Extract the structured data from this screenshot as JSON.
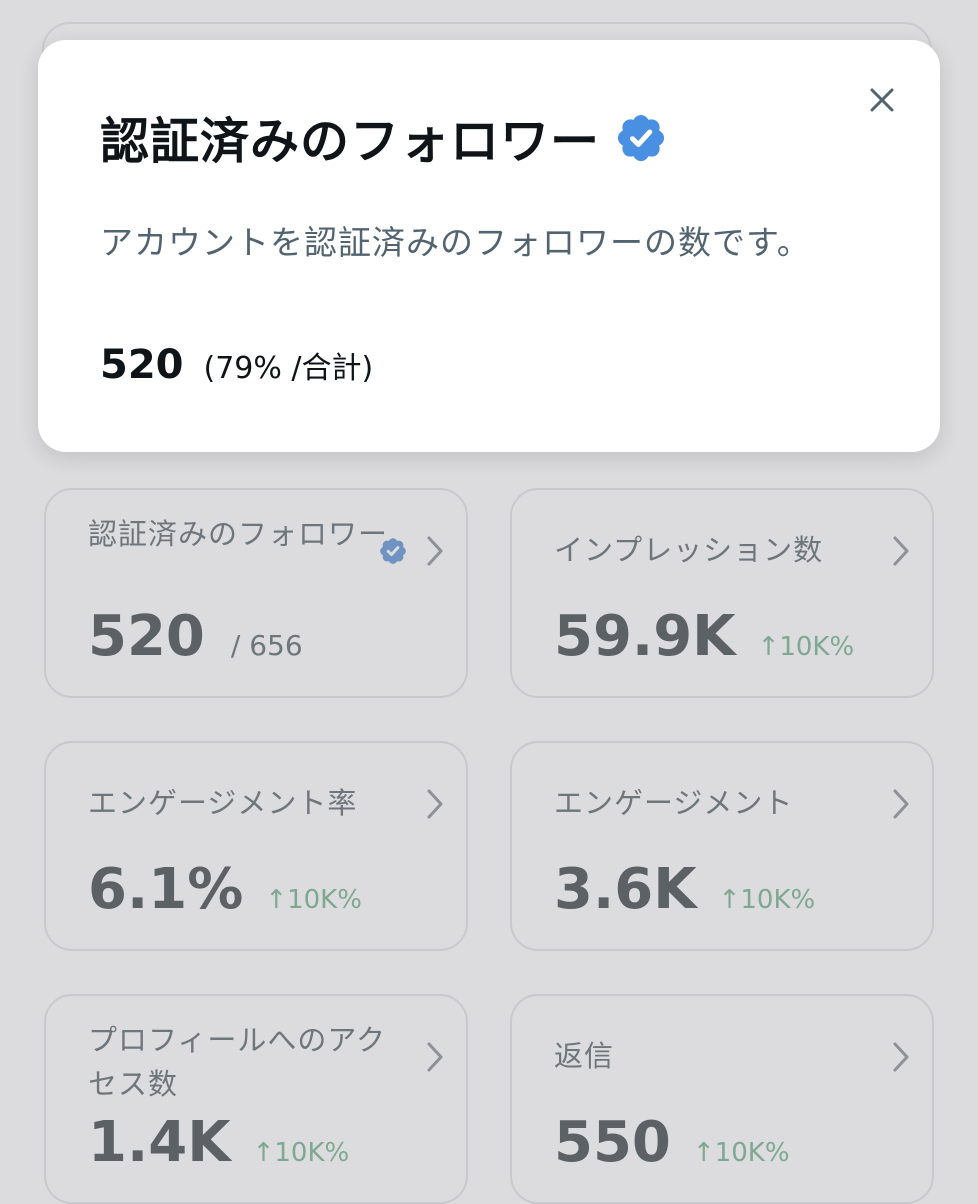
{
  "popover": {
    "title": "認証済みのフォロワー",
    "description": "アカウントを認証済みのフォロワーの数です。",
    "value": "520",
    "percent_note": "(79% /合計)",
    "verified_color": "#4a90e2"
  },
  "cards": [
    {
      "label": "認証済みのフォロワー",
      "value": "520",
      "sub": "/ 656"
    },
    {
      "label": "インプレッション数",
      "value": "59.9K",
      "trend": "↑10K%"
    },
    {
      "label": "エンゲージメント率",
      "value": "6.1%",
      "trend": "↑10K%"
    },
    {
      "label": "エンゲージメント",
      "value": "3.6K",
      "trend": "↑10K%"
    },
    {
      "label": "プロフィールへのアクセス数",
      "value": "1.4K",
      "trend": "↑10K%"
    },
    {
      "label": "返信",
      "value": "550",
      "trend": "↑10K%"
    }
  ],
  "icons": {
    "close": "close-icon",
    "verified": "verified-badge-icon",
    "chevron": "chevron-right-icon"
  }
}
